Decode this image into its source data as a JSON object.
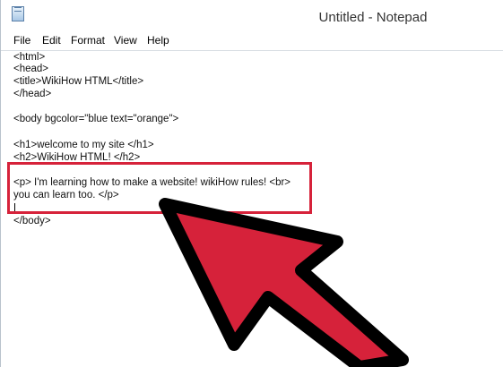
{
  "window": {
    "title": "Untitled - Notepad",
    "icon": "notepad-icon"
  },
  "menu": {
    "file": "File",
    "edit": "Edit",
    "format": "Format",
    "view": "View",
    "help": "Help"
  },
  "editor": {
    "lines": [
      "<html>",
      "<head>",
      "<title>WikiHow HTML</title>",
      "</head>",
      "",
      "<body bgcolor=\"blue text=\"orange\">",
      "",
      "<h1>welcome to my site </h1>",
      "<h2>WikiHow HTML! </h2>",
      "",
      "<p> I'm learning how to make a website! wikiHow rules! <br>",
      "you can learn too. </p>",
      "",
      "</body>"
    ]
  },
  "colors": {
    "highlight": "#d6223a",
    "arrow_fill": "#d6223a",
    "arrow_stroke": "#000000"
  }
}
